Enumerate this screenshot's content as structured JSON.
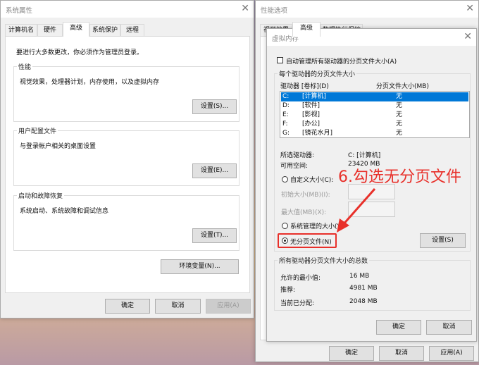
{
  "system_properties": {
    "title": "系统属性",
    "tabs": [
      "计算机名",
      "硬件",
      "高级",
      "系统保护",
      "远程"
    ],
    "active_tab": "高级",
    "admin_note": "要进行大多数更改，你必须作为管理员登录。",
    "performance": {
      "label": "性能",
      "desc": "视觉效果，处理器计划，内存使用，以及虚拟内存",
      "button": "设置(S)..."
    },
    "user_profiles": {
      "label": "用户配置文件",
      "desc": "与登录帐户相关的桌面设置",
      "button": "设置(E)..."
    },
    "startup_recovery": {
      "label": "启动和故障恢复",
      "desc": "系统启动、系统故障和调试信息",
      "button": "设置(T)..."
    },
    "env_button": "环境变量(N)...",
    "ok": "确定",
    "cancel": "取消",
    "apply": "应用(A)"
  },
  "performance_options": {
    "title": "性能选项",
    "tabs": [
      "视觉效果",
      "高级",
      "数据执行保护"
    ],
    "ok": "确定",
    "cancel": "取消",
    "apply": "应用(A)"
  },
  "virtual_memory": {
    "title": "虚拟内存",
    "auto_manage_label": "自动管理所有驱动器的分页文件大小(A)",
    "auto_manage_checked": false,
    "per_drive_group": "每个驱动器的分页文件大小",
    "col_drive": "驱动器 [卷标](D)",
    "col_size": "分页文件大小(MB)",
    "drives": [
      {
        "drive": "C:",
        "label": "[计算机]",
        "size": "无",
        "selected": true
      },
      {
        "drive": "D:",
        "label": "[软件]",
        "size": "无"
      },
      {
        "drive": "E:",
        "label": "[影视]",
        "size": "无"
      },
      {
        "drive": "F:",
        "label": "[办公]",
        "size": "无"
      },
      {
        "drive": "G:",
        "label": "[镜花水月]",
        "size": "无"
      }
    ],
    "selected_drive_label": "所选驱动器:",
    "selected_drive_value": "C:  [计算机]",
    "free_space_label": "可用空间:",
    "free_space_value": "23420 MB",
    "custom_size": "自定义大小(C):",
    "initial_size": "初始大小(MB)(I):",
    "max_size": "最大值(MB)(X):",
    "system_managed": "系统管理的大小(Y)",
    "no_paging": "无分页文件(N)",
    "selected_option": "no_paging",
    "set_button": "设置(S)",
    "total_group": "所有驱动器分页文件大小的总数",
    "min_allowed_label": "允许的最小值:",
    "min_allowed_value": "16 MB",
    "recommended_label": "推荐:",
    "recommended_value": "4981 MB",
    "current_label": "当前已分配:",
    "current_value": "2048 MB",
    "ok": "确定",
    "cancel": "取消"
  },
  "annotation": {
    "text": "6.勾选无分页文件",
    "color": "#e8302a"
  },
  "colors": {
    "selection": "#0078d7"
  }
}
